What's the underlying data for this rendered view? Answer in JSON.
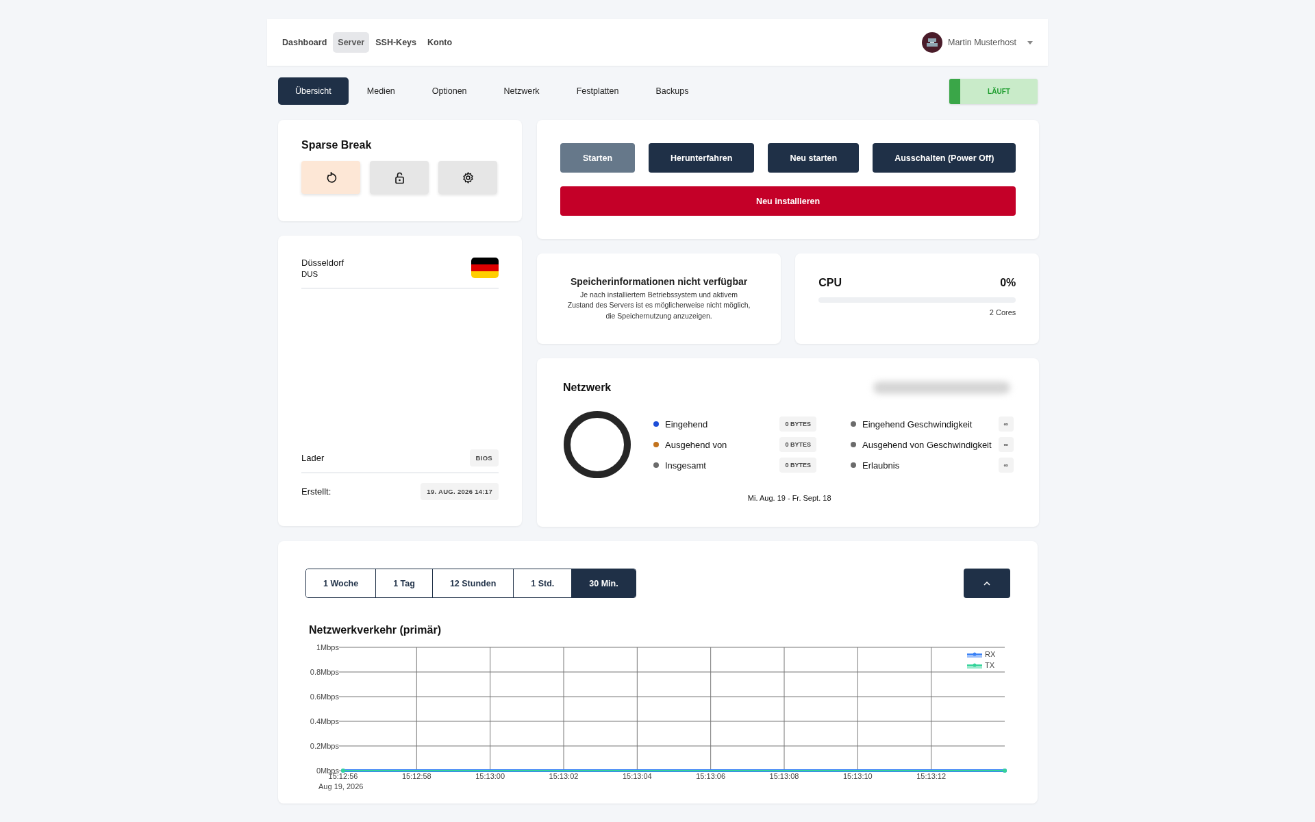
{
  "top_nav": {
    "items": [
      {
        "label": "Dashboard",
        "selected": false
      },
      {
        "label": "Server",
        "selected": true
      },
      {
        "label": "SSH-Keys",
        "selected": false
      },
      {
        "label": "Konto",
        "selected": false
      }
    ],
    "user": {
      "name": "Martin Musterhost"
    }
  },
  "subtabs": [
    {
      "label": "Übersicht",
      "selected": true
    },
    {
      "label": "Medien",
      "selected": false
    },
    {
      "label": "Optionen",
      "selected": false
    },
    {
      "label": "Netzwerk",
      "selected": false
    },
    {
      "label": "Festplatten",
      "selected": false
    },
    {
      "label": "Backups",
      "selected": false
    }
  ],
  "status": {
    "label": "LÄUFT",
    "kind": "running"
  },
  "server": {
    "name": "Sparse Break",
    "quick_actions": [
      {
        "kind": "reset",
        "selected": true
      },
      {
        "kind": "unlock",
        "selected": false
      },
      {
        "kind": "settings",
        "selected": false
      }
    ]
  },
  "location": {
    "city": "Düsseldorf",
    "code": "DUS"
  },
  "details": [
    {
      "label": "Lader",
      "value": "BIOS"
    },
    {
      "label": "Erstellt:",
      "value": "19. AUG. 2026 14:17"
    }
  ],
  "power_actions": [
    {
      "label": "Starten",
      "disabled": true
    },
    {
      "label": "Herunterfahren",
      "disabled": false
    },
    {
      "label": "Neu starten",
      "disabled": false
    },
    {
      "label": "Ausschalten (Power Off)",
      "disabled": false
    }
  ],
  "reinstall": {
    "label": "Neu installieren"
  },
  "memory": {
    "title": "Speicherinformationen nicht verfügbar",
    "text": "Je nach installiertem Betriebssystem und aktivem Zustand des Servers ist es möglicherweise nicht möglich, die Speichernutzung anzuzeigen."
  },
  "cpu": {
    "label": "CPU",
    "reading": "0%",
    "level": 0,
    "cores": "2 Cores"
  },
  "network": {
    "title": "Netzwerk",
    "traffic": [
      {
        "label": "Eingehend",
        "value": "0 BYTES",
        "color": "#1d4ed8"
      },
      {
        "label": "Ausgehend von",
        "value": "0 BYTES",
        "color": "#c2731e"
      },
      {
        "label": "Insgesamt",
        "value": "0 BYTES",
        "color": "#6b6b6b"
      }
    ],
    "limits": [
      {
        "label": "Eingehend Geschwindigkeit",
        "value": "∞",
        "color": "#6b6b6b"
      },
      {
        "label": "Ausgehend von Geschwindigkeit",
        "value": "∞",
        "color": "#6b6b6b"
      },
      {
        "label": "Erlaubnis",
        "value": "∞",
        "color": "#6b6b6b"
      }
    ],
    "period": "Mi. Aug. 19 - Fr. Sept. 18"
  },
  "ranges": [
    {
      "label": "1 Woche",
      "selected": false
    },
    {
      "label": "1 Tag",
      "selected": false
    },
    {
      "label": "12 Stunden",
      "selected": false
    },
    {
      "label": "1 Std.",
      "selected": false
    },
    {
      "label": "30 Min.",
      "selected": true
    }
  ],
  "traffic_chart": {
    "title": "Netzwerkverkehr (primär)",
    "date_label": "Aug 19, 2026",
    "chart_data": {
      "type": "line",
      "categories": [
        "15:12:56",
        null,
        "15:12:58",
        null,
        "15:13:00",
        null,
        "15:13:02",
        null,
        "15:13:04",
        null,
        "15:13:06",
        null,
        "15:13:08",
        null,
        "15:13:10",
        null,
        "15:13:12",
        null,
        null
      ],
      "series": [
        {
          "name": "RX",
          "color": "#3b82f6",
          "values": [
            0,
            0,
            0,
            0,
            0,
            0,
            0,
            0,
            0,
            0,
            0,
            0,
            0,
            0,
            0,
            0,
            0,
            0,
            0
          ]
        },
        {
          "name": "TX",
          "color": "#34d399",
          "values": [
            0,
            0,
            0,
            0,
            0,
            0,
            0,
            0,
            0,
            0,
            0,
            0,
            0,
            0,
            0,
            0,
            0,
            0,
            0
          ]
        }
      ],
      "ylim": [
        0,
        1
      ],
      "grid": true,
      "legend": true,
      "yticks": [
        {
          "value": 0,
          "label": "0Mbps"
        },
        {
          "value": 0.2,
          "label": "0.2Mbps"
        },
        {
          "value": 0.4,
          "label": "0.4Mbps"
        },
        {
          "value": 0.6,
          "label": "0.6Mbps"
        },
        {
          "value": 0.8,
          "label": "0.8Mbps"
        },
        {
          "value": 1,
          "label": "1Mbps"
        }
      ]
    }
  }
}
